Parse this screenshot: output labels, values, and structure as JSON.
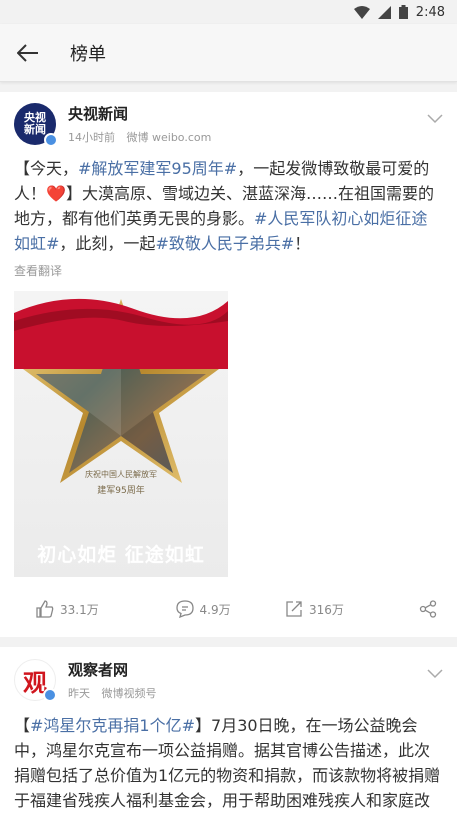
{
  "status": {
    "time": "2:48"
  },
  "topbar": {
    "title": "榜单"
  },
  "posts": [
    {
      "avatar_text": "央视新闻",
      "username": "央视新闻",
      "time": "14小时前",
      "source": "微博 weibo.com",
      "text_parts": [
        {
          "t": "【今天，",
          "tag": false
        },
        {
          "t": "#解放军建军95周年#",
          "tag": true
        },
        {
          "t": "，一起发微博致敬最可爱的人！",
          "tag": false
        },
        {
          "t": "❤️",
          "tag": false
        },
        {
          "t": "】大漠高原、雪域边关、湛蓝深海……在祖国需要的地方，都有他们英勇无畏的身影。",
          "tag": false
        },
        {
          "t": "#人民军队初心如炬征途如虹#",
          "tag": true
        },
        {
          "t": "，此刻，一起",
          "tag": false
        },
        {
          "t": "#致敬人民子弟兵#",
          "tag": true
        },
        {
          "t": "！",
          "tag": false
        }
      ],
      "translate": "查看翻译",
      "poster": {
        "caption_line1": "庆祝中国人民解放军",
        "caption_line2": "建军95周年",
        "slogan": "初心如炬  征途如虹"
      },
      "actions": {
        "likes": "33.1万",
        "comments": "4.9万",
        "reposts": "316万"
      }
    },
    {
      "avatar_text": "观",
      "username": "观察者网",
      "time": "昨天",
      "source": "微博视频号",
      "text_parts": [
        {
          "t": "【",
          "tag": false
        },
        {
          "t": "#鸿星尔克再捐1个亿#",
          "tag": true
        },
        {
          "t": "】7月30日晚，在一场公益晚会中，鸿星尔克宣布一项公益捐赠。据其官博公告描述，此次捐赠包括了总价值为1亿元的物资和捐款，而该款物将被捐赠于福建省残疾人福利基金会，用于帮助困难残疾人和家庭改善生活质量，网友评论：踩了一年缝纫机，这家伙又都捐",
          "tag": false
        }
      ]
    }
  ],
  "colors": {
    "tag": "#4a6fa5",
    "verified": "#4a90e2",
    "banner": "#c8102e"
  }
}
